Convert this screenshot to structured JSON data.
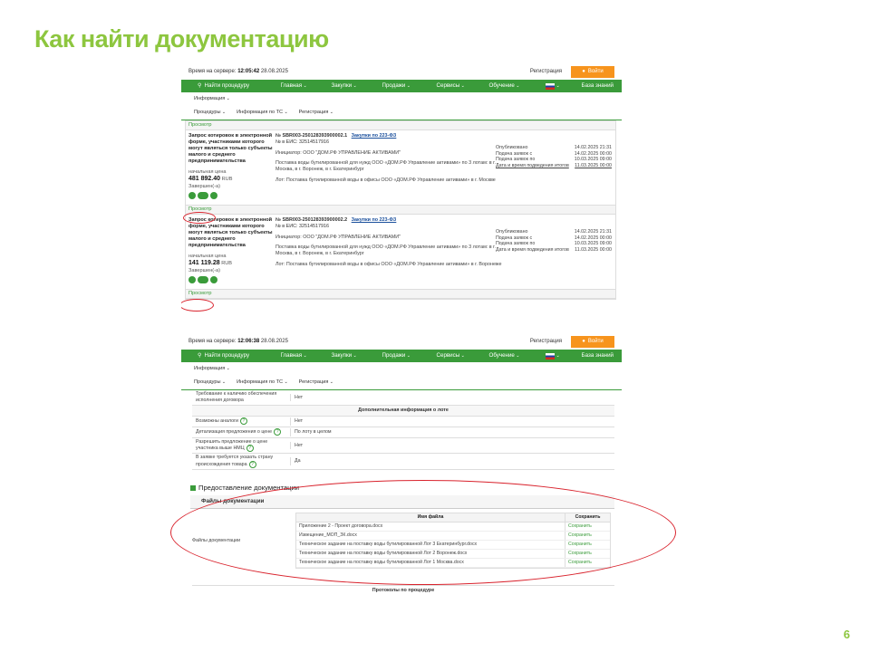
{
  "slide": {
    "title": "Как найти документацию",
    "page_number": "6"
  },
  "shot1": {
    "server_time_label": "Время на сервере:",
    "server_time": "12:05:42",
    "server_date": "28.08.2025",
    "register": "Регистрация",
    "login": "Войти",
    "nav": [
      "Найти процедуру",
      "Главная",
      "Закупки",
      "Продажи",
      "Сервисы",
      "Обучение",
      "База знаний"
    ],
    "info": "Информация",
    "subnav": [
      "Процедуры",
      "Информация по ТС",
      "Регистрация"
    ],
    "view_label": "Просмотр",
    "lots": [
      {
        "title": "Запрос котировок в электронной форме, участниками которого могут являться только субъекты малого и среднего предпринимательства",
        "number": "№ SBR003-250128393900002.1",
        "law": "Закупки по 223-ФЗ",
        "eis": "№ в ЕИС: 32514517916",
        "initiator": "Инициатор: ООО \"ДОМ.РФ УПРАВЛЕНИЕ АКТИВАМИ\"",
        "subject": "Поставка воды бутилированной для нужд ООО «ДОМ.РФ Управление активами» по 3 лотам: в г. Москва, в г. Воронеж, в г. Екатеринбург",
        "lot_text": "Лот: Поставка бутилированной воды в офисы ООО «ДОМ.РФ Управление активами» в г. Москве",
        "price_label": "начальная цена",
        "price": "481 892.40",
        "currency": "RUB",
        "completed": "Завершен(-а)",
        "published_label": "Опубликовано",
        "published": "14.02.2025 21:31",
        "start_label": "Подача заявок с",
        "start": "14.02.2025 00:00",
        "end_label": "Подача заявок по",
        "end": "10.03.2025 09:00",
        "results_label": "Дата и время подведения итогов",
        "results": "11.03.2025 00:00"
      },
      {
        "title": "Запрос котировок в электронной форме, участниками которого могут являться только субъекты малого и среднего предпринимательства",
        "number": "№ SBR003-250128393900002.2",
        "law": "Закупки по 223-ФЗ",
        "eis": "№ в ЕИС: 32514517916",
        "initiator": "Инициатор: ООО \"ДОМ.РФ УПРАВЛЕНИЕ АКТИВАМИ\"",
        "subject": "Поставка воды бутилированной для нужд ООО «ДОМ.РФ Управление активами» по 3 лотам: в г. Москва, в г. Воронеж, в г. Екатеринбург",
        "lot_text": "Лот: Поставка бутилированной воды в офисы ООО «ДОМ.РФ Управление активами» в г. Воронеже",
        "price_label": "начальная цена",
        "price": "141 119.28",
        "currency": "RUB",
        "completed": "Завершен(-а)",
        "published_label": "Опубликовано",
        "published": "14.02.2025 21:31",
        "start_label": "Подача заявок с",
        "start": "14.02.2025 00:00",
        "end_label": "Подача заявок по",
        "end": "10.03.2025 09:00",
        "results_label": "Дата и время подведения итогов",
        "results": "11.03.2025 00:00"
      }
    ]
  },
  "shot2": {
    "server_time_label": "Время на сервере:",
    "server_time": "12:06:38",
    "server_date": "28.08.2025",
    "register": "Регистрация",
    "login": "Войти",
    "nav": [
      "Найти процедуру",
      "Главная",
      "Закупки",
      "Продажи",
      "Сервисы",
      "Обучение",
      "База знаний"
    ],
    "info": "Информация",
    "subnav": [
      "Процедуры",
      "Информация по ТС",
      "Регистрация"
    ],
    "req_rows": [
      {
        "k": "Требование к наличию обеспечения исполнения договора",
        "v": "Нет"
      }
    ],
    "extra_header": "Дополнительная информация о лоте",
    "extra_rows": [
      {
        "k": "Возможны аналоги",
        "v": "Нет",
        "q": true
      },
      {
        "k": "Детализация предложения о цене",
        "v": "По лоту в целом",
        "q": true
      },
      {
        "k": "Разрешить предложение о цене участника выше НМЦ",
        "v": "Нет",
        "q": true
      },
      {
        "k": "В заявке требуется указать страну происхождения товара",
        "v": "Да",
        "q": true
      }
    ],
    "docs_title": "Предоставление документации",
    "docs_sub": "Файлы документации",
    "files_label": "Файлы документации",
    "col_name": "Имя файла",
    "col_save": "Сохранить",
    "files": [
      {
        "name": "Приложение 2 - Проект договора.docx",
        "save": "Сохранить"
      },
      {
        "name": "Извещение_МОП_ЗК.docx",
        "save": "Сохранить"
      },
      {
        "name": "Техническое задание на поставку воды бутилированной Лот 3 Екатеринбург.docx",
        "save": "Сохранить"
      },
      {
        "name": "Техническое задание на поставку воды бутилированной Лот 2 Воронеж.docx",
        "save": "Сохранить"
      },
      {
        "name": "Техническое задание на поставку воды бутилированной Лот 1 Москва.docx",
        "save": "Сохранить"
      }
    ],
    "protocols": "Протоколы по процедуре"
  }
}
